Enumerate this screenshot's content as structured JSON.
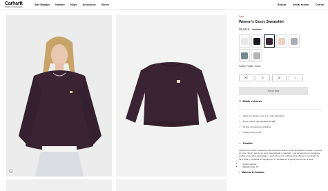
{
  "header": {
    "logo": "Carhartt",
    "logo_sub": "WORK IN PROGRESS",
    "nav": [
      "Sale Rebajas",
      "Hombre",
      "Mujer",
      "Accesorios",
      "Stores"
    ],
    "right": [
      "Buscar",
      "Iniciar sesión",
      "Carrito"
    ]
  },
  "product": {
    "badge": "Sale",
    "name": "Women's Casey Sweatshirt",
    "price": "39,50 €",
    "old_price": "79,00 €",
    "color_label": "Casey Purple / Silver",
    "swatches": [
      {
        "color": "#e9e9e9"
      },
      {
        "color": "#1b1b1f"
      },
      {
        "color": "#3a2433"
      },
      {
        "color": "#e7d2c4"
      },
      {
        "color": "#a9adb6"
      },
      {
        "color": "#6f8b94"
      },
      {
        "color": "#b5b5b5"
      }
    ],
    "sizes": [
      "XS",
      "S",
      "M",
      "L"
    ],
    "size_button": "Elegir talla",
    "wishlist": "Añadir a deseos",
    "benefits": [
      "Plazo de entrega: entre 2 a 4 días laborables",
      "Envío gratuito para pedidos de 99€",
      "30 días devoluciones gratuitas",
      "Pedido mínimo 20 €"
    ],
    "details_title": "Detalles",
    "description": "La Women's Casey Sweatshirt está confeccionada en punto de algodón pesado. Presenta un corte \"boxy\", que es un poco más holgado y cuadrado, y se caracteriza por tendones cuellos y los puños acanalados. La prenda se ha cepillado para obtener un acabado de forro polar, y presenta un logotipo de \"C\" bordado en el pecho a tono con el color.",
    "details_list": [
      "Cuello redondo",
      "I032042_06H_XX"
    ],
    "care_title": "Material & Cuidado"
  }
}
